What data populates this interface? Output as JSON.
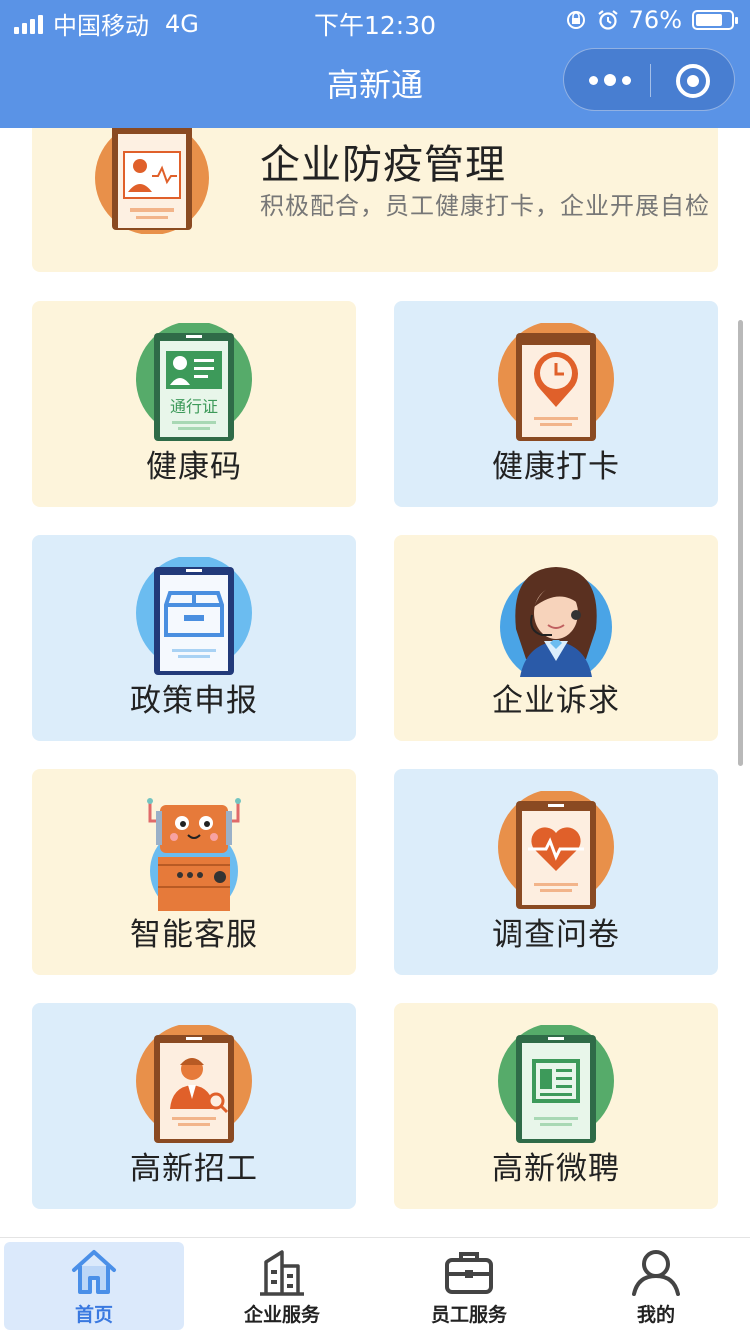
{
  "status_bar": {
    "carrier": "中国移动",
    "network": "4G",
    "time": "下午12:30",
    "battery_percent": "76%",
    "battery_level": 0.76
  },
  "nav": {
    "title": "高新通",
    "more_icon": "more-dots-icon",
    "close_icon": "target-circle-icon"
  },
  "banner": {
    "title": "企业防疫管理",
    "subtitle": "积极配合，员工健康打卡，企业开展自检",
    "icon": "monitor-person-icon"
  },
  "grid": [
    {
      "label": "健康码",
      "icon": "pass-card-icon",
      "color": "#fdf4db",
      "icon_text": "通行证"
    },
    {
      "label": "健康打卡",
      "icon": "clock-pin-icon",
      "color": "#dcedfa"
    },
    {
      "label": "政策申报",
      "icon": "box-document-icon",
      "color": "#dcedfa"
    },
    {
      "label": "企业诉求",
      "icon": "customer-service-woman-icon",
      "color": "#fdf4db"
    },
    {
      "label": "智能客服",
      "icon": "robot-icon",
      "color": "#fdf4db"
    },
    {
      "label": "调查问卷",
      "icon": "heart-pulse-icon",
      "color": "#dcedfa"
    },
    {
      "label": "高新招工",
      "icon": "recruit-person-icon",
      "color": "#dcedfa"
    },
    {
      "label": "高新微聘",
      "icon": "newspaper-icon",
      "color": "#fdf4db"
    }
  ],
  "tabbar": [
    {
      "label": "首页",
      "icon": "home-icon",
      "active": true
    },
    {
      "label": "企业服务",
      "icon": "building-icon",
      "active": false
    },
    {
      "label": "员工服务",
      "icon": "briefcase-icon",
      "active": false
    },
    {
      "label": "我的",
      "icon": "user-icon",
      "active": false
    }
  ],
  "colors": {
    "header_blue": "#5a93e6",
    "card_yellow": "#fdf4db",
    "card_blue": "#dcedfa",
    "tab_active": "#3a79e0"
  }
}
